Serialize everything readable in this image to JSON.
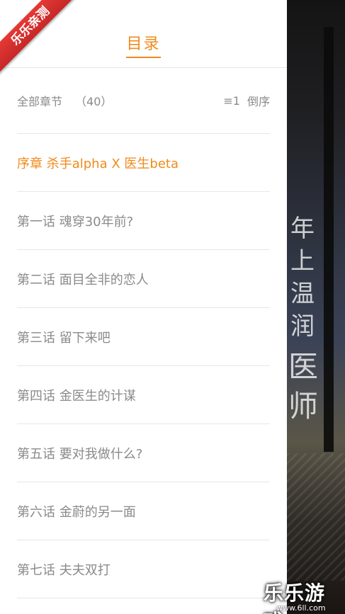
{
  "drawer": {
    "title": "目录",
    "all_chapters_label": "全部章节",
    "chapter_count": "（40）",
    "sort_icon": "≡1",
    "sort_label": "倒序",
    "chapters": [
      {
        "label": "序章 杀手alpha X 医生beta",
        "active": true
      },
      {
        "label": "第一话 魂穿30年前?",
        "active": false
      },
      {
        "label": "第二话 面目全非的恋人",
        "active": false
      },
      {
        "label": "第三话 留下来吧",
        "active": false
      },
      {
        "label": "第四话 金医生的计谋",
        "active": false
      },
      {
        "label": "第五话 要对我做什么?",
        "active": false
      },
      {
        "label": "第六话 金蔚的另一面",
        "active": false
      },
      {
        "label": "第七话 夫夫双打",
        "active": false
      }
    ]
  },
  "cover": {
    "vertical_text_top": "年上温润",
    "vertical_text_bottom": "医师"
  },
  "watermark": {
    "ribbon_text": "乐乐亲测",
    "logo_text": "乐乐游戏",
    "url": "www.6ll.com"
  },
  "colors": {
    "accent": "#f08a1c",
    "text_muted": "#8a8a8a",
    "divider": "#e6e6e6"
  }
}
